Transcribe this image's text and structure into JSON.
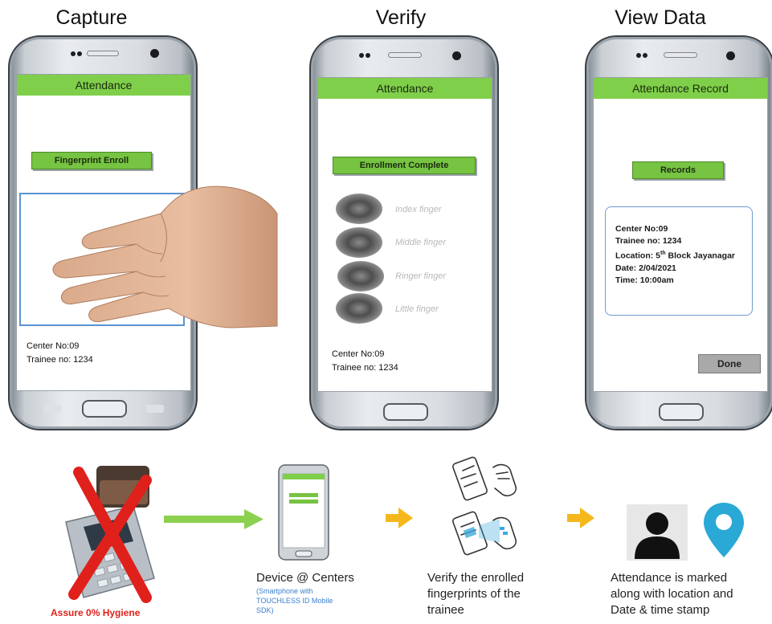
{
  "steps": {
    "capture": "Capture",
    "verify": "Verify",
    "view_data": "View Data"
  },
  "phone_capture": {
    "appbar": "Attendance",
    "button": "Fingerprint Enroll",
    "info": "Center No:09\nTrainee no: 1234"
  },
  "phone_verify": {
    "appbar": "Attendance",
    "button": "Enrollment Complete",
    "fingers": [
      "Index finger",
      "Middle finger",
      "Ringer finger",
      "Little finger"
    ],
    "info": "Center No:09\nTrainee no: 1234"
  },
  "phone_view": {
    "appbar": "Attendance Record",
    "button": "Records",
    "record": {
      "center": "Center No:09",
      "trainee": "Trainee no: 1234",
      "location_prefix": "Location: 5",
      "location_sup": "th",
      "location_suffix": " Block Jayanagar",
      "date": "Date: 2/04/2021",
      "time": "Time: 10:00am"
    },
    "done": "Done"
  },
  "flow": {
    "hygiene": "Assure 0% Hygiene",
    "device_title": "Device @ Centers",
    "device_sub": "(Smartphone with\nTOUCHLESS ID Mobile\nSDK)",
    "verify_text": "Verify the enrolled\nfingerprints of the\ntrainee",
    "attendance_text": "Attendance is marked\nalong with location and\nDate & time stamp"
  },
  "colors": {
    "accent_green": "#7fcf4a",
    "arrow_yellow": "#f5b81c",
    "cross_red": "#e0201b",
    "location_pin": "#2aa9d6",
    "sub_blue": "#3a7fd0"
  }
}
